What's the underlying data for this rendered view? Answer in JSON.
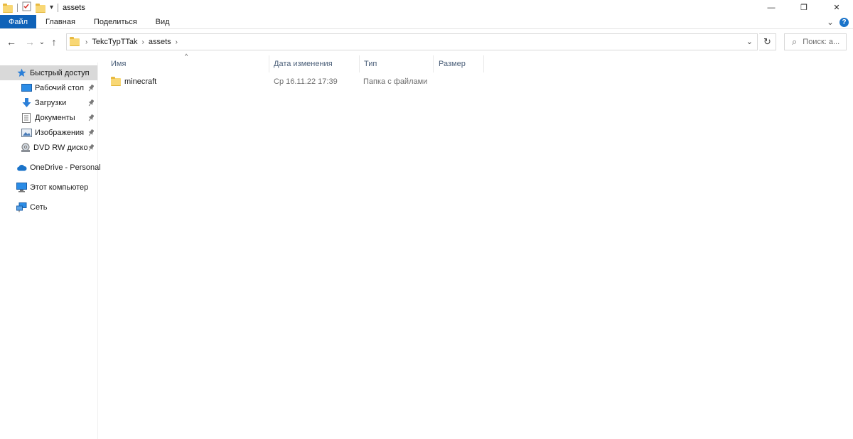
{
  "titlebar": {
    "title": "assets",
    "qat_dropdown": "▾",
    "controls": {
      "minimize": "—",
      "maximize": "❐",
      "close": "✕"
    }
  },
  "ribbon": {
    "tabs": [
      "Файл",
      "Главная",
      "Поделиться",
      "Вид"
    ],
    "expand": "⌄",
    "help": "?"
  },
  "nav": {
    "back": "←",
    "forward": "→",
    "recent": "⌄",
    "up": "↑"
  },
  "address": {
    "crumbs": [
      "TekcTypTTak",
      "assets"
    ],
    "separator": "›",
    "dropdown": "⌄",
    "refresh": "↻"
  },
  "search": {
    "placeholder": "Поиск: a...",
    "icon": "⌕"
  },
  "sidebar": {
    "items": [
      {
        "label": "Быстрый доступ",
        "icon": "star-icon",
        "selected": true,
        "pinned": false
      },
      {
        "label": "Рабочий стол",
        "icon": "desktop-icon",
        "pinned": true
      },
      {
        "label": "Загрузки",
        "icon": "downloads-icon",
        "pinned": true
      },
      {
        "label": "Документы",
        "icon": "documents-icon",
        "pinned": true
      },
      {
        "label": "Изображения",
        "icon": "pictures-icon",
        "pinned": true
      },
      {
        "label": "DVD RW дисков",
        "icon": "dvd-drive-icon",
        "pinned": true
      },
      {
        "label": "OneDrive - Personal",
        "icon": "onedrive-icon",
        "pinned": false
      },
      {
        "label": "Этот компьютер",
        "icon": "computer-icon",
        "pinned": false
      },
      {
        "label": "Сеть",
        "icon": "network-icon",
        "pinned": false
      }
    ],
    "pin_glyph": "📌"
  },
  "columns": {
    "name": "Имя",
    "date": "Дата изменения",
    "type": "Тип",
    "size": "Размер",
    "sort_indicator": "^"
  },
  "files": [
    {
      "name": "minecraft",
      "date": "Ср 16.11.22 17:39",
      "type": "Папка с файлами",
      "size": ""
    }
  ],
  "colors": {
    "file_tab": "#0f62b8",
    "selected_nav": "#d9d9d9",
    "folder": "#f8d775",
    "column_header_text": "#4c607a"
  }
}
